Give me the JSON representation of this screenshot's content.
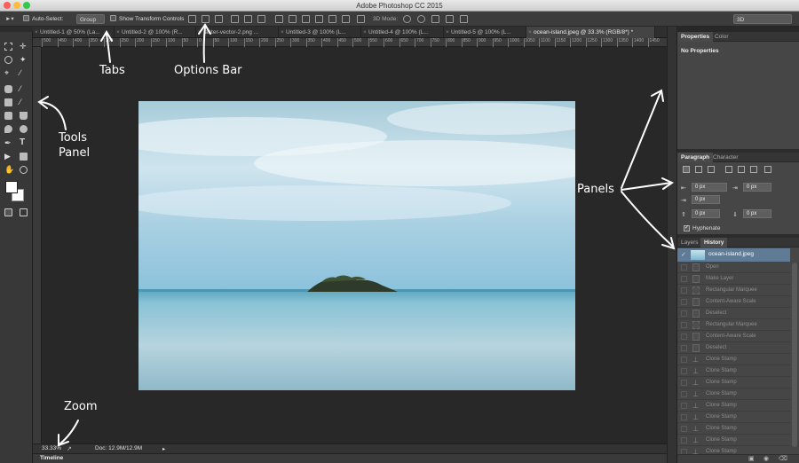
{
  "window": {
    "title": "Adobe Photoshop CC 2015"
  },
  "options_bar": {
    "auto_select_label": "Auto-Select:",
    "auto_select_value": "Group",
    "show_transform_label": "Show Transform Controls",
    "mode_3d_label": "3D Mode:",
    "workspace_value": "3D"
  },
  "tabs": [
    {
      "label": "Untitled-1 @ 50% (La..."
    },
    {
      "label": "Untitled-2 @ 100% (R..."
    },
    {
      "label": "raster-vector-2.png ..."
    },
    {
      "label": "Untitled-3 @ 100% (L..."
    },
    {
      "label": "Untitled-4 @ 100% (L..."
    },
    {
      "label": "Untitled-5 @ 100% (L..."
    },
    {
      "label": "ocean-island.jpeg @ 33.3% (RGB/8*) *"
    }
  ],
  "ruler_ticks": [
    "500",
    "450",
    "400",
    "350",
    "300",
    "250",
    "200",
    "150",
    "100",
    "50",
    "0",
    "50",
    "100",
    "150",
    "200",
    "250",
    "300",
    "350",
    "400",
    "450",
    "500",
    "550",
    "600",
    "650",
    "700",
    "750",
    "800",
    "850",
    "900",
    "950",
    "1000",
    "1050",
    "1100",
    "1150",
    "1200",
    "1250",
    "1300",
    "1350",
    "1400",
    "1450"
  ],
  "status": {
    "zoom": "33.33%",
    "doc": "Doc: 12.9M/12.9M"
  },
  "timeline_label": "Timeline",
  "properties_panel": {
    "tabs": [
      "Properties",
      "Color"
    ],
    "content": "No Properties"
  },
  "paragraph_panel": {
    "tabs": [
      "Paragraph",
      "Character"
    ],
    "indent_left": "0 px",
    "indent_right": "0 px",
    "first_line": "0 px",
    "space_before": "0 px",
    "space_after": "0 px",
    "hyphenate_label": "Hyphenate"
  },
  "history_panel": {
    "tabs": [
      "Layers",
      "History"
    ],
    "snapshot": "ocean-island.jpeg",
    "steps": [
      "Open",
      "Make Layer",
      "Rectangular Marquee",
      "Content-Aware Scale",
      "Deselect",
      "Rectangular Marquee",
      "Content-Aware Scale",
      "Deselect",
      "Clone Stamp",
      "Clone Stamp",
      "Clone Stamp",
      "Clone Stamp",
      "Clone Stamp",
      "Clone Stamp",
      "Clone Stamp",
      "Clone Stamp",
      "Clone Stamp"
    ]
  },
  "annotations": {
    "tabs": "Tabs",
    "options_bar": "Options Bar",
    "tools_panel_line1": "Tools",
    "tools_panel_line2": "Panel",
    "panels": "Panels",
    "zoom": "Zoom"
  }
}
